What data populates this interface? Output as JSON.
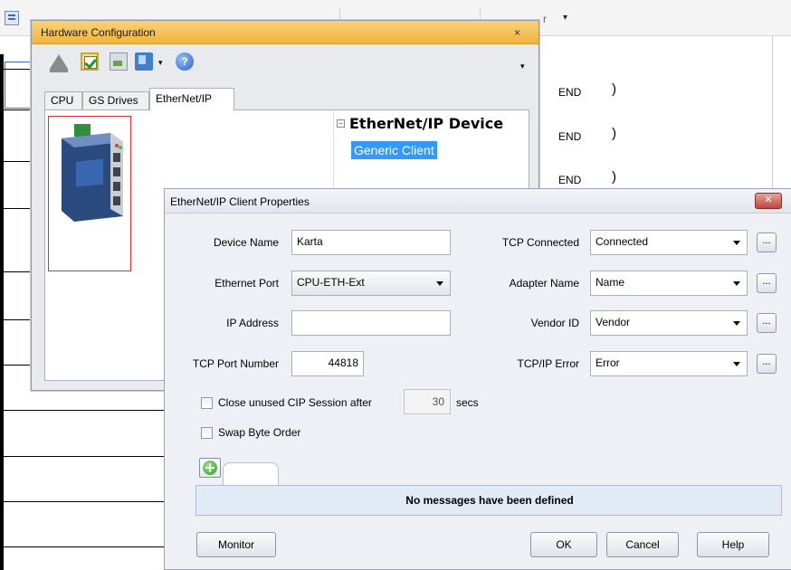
{
  "background": {
    "caret_text": "r",
    "end_rows": [
      {
        "label": "END",
        "paren": ")"
      },
      {
        "label": "END",
        "paren": ")"
      },
      {
        "label": "END",
        "paren": ")"
      }
    ]
  },
  "hw_window": {
    "title": "Hardware Configuration",
    "close": "×",
    "toolbar": {
      "help_glyph": "?",
      "dropdown_caret": "▾",
      "caret": "▾"
    },
    "tabs": [
      "CPU",
      "GS Drives",
      "EtherNet/IP"
    ],
    "tree": {
      "toggle": "−",
      "header": "EtherNet/IP Device",
      "selected_child": "Generic Client"
    }
  },
  "dialog": {
    "title": "EtherNet/IP Client Properties",
    "close": "✕",
    "fields": {
      "device_name": {
        "label": "Device Name",
        "value": "Karta"
      },
      "ethernet_port": {
        "label": "Ethernet Port",
        "value": "CPU-ETH-Ext"
      },
      "ip_address": {
        "label": "IP Address",
        "value": ""
      },
      "tcp_port": {
        "label": "TCP Port Number",
        "value": "44818"
      },
      "tcp_connected": {
        "label": "TCP Connected",
        "value": "Connected"
      },
      "adapter_name": {
        "label": "Adapter Name",
        "value": "Name"
      },
      "vendor_id": {
        "label": "Vendor ID",
        "value": "Vendor"
      },
      "tcpip_error": {
        "label": "TCP/IP Error",
        "value": "Error"
      }
    },
    "ellipsis": "...",
    "close_unused": {
      "label": "Close unused CIP Session after",
      "value": "30",
      "unit": "secs"
    },
    "swap_byte": {
      "label": "Swap Byte Order"
    },
    "messages_empty": "No messages have been defined",
    "buttons": {
      "monitor": "Monitor",
      "ok": "OK",
      "cancel": "Cancel",
      "help": "Help"
    }
  },
  "colors": {
    "selection": "#3399ff",
    "device_border": "#e03030",
    "title_orange": "#f0b43c",
    "close_red": "#c0463a"
  }
}
